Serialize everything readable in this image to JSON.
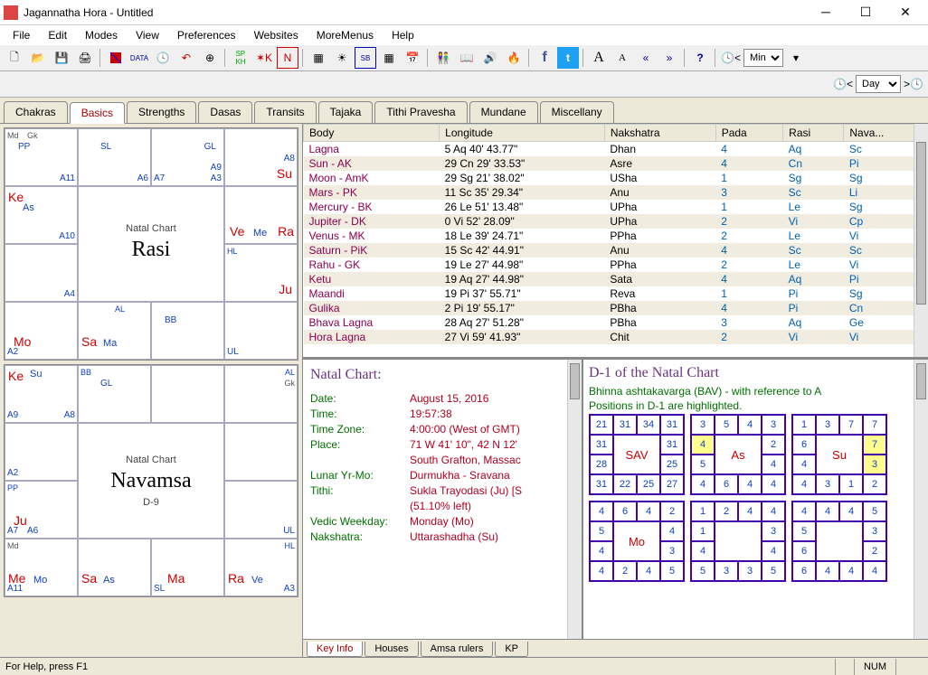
{
  "window": {
    "title": "Jagannatha Hora - Untitled"
  },
  "menu": [
    "File",
    "Edit",
    "Modes",
    "View",
    "Preferences",
    "Websites",
    "MoreMenus",
    "Help"
  ],
  "toolbar_combo1": "Min",
  "toolbar_combo2": "Day",
  "tabs": [
    "Chakras",
    "Basics",
    "Strengths",
    "Dasas",
    "Transits",
    "Tajaka",
    "Tithi Pravesha",
    "Mundane",
    "Miscellany"
  ],
  "tabs_active": 1,
  "rasi_chart": {
    "header": "Natal Chart",
    "big": "Rasi"
  },
  "navamsa_chart": {
    "header": "Natal Chart",
    "big": "Navamsa",
    "sub": "D-9"
  },
  "body_table": {
    "headers": [
      "Body",
      "Longitude",
      "Nakshatra",
      "Pada",
      "Rasi",
      "Nava..."
    ],
    "rows": [
      [
        "Lagna",
        "5 Aq 40' 43.77\"",
        "Dhan",
        "4",
        "Aq",
        "Sc"
      ],
      [
        "Sun - AK",
        "29 Cn 29' 33.53\"",
        "Asre",
        "4",
        "Cn",
        "Pi"
      ],
      [
        "Moon - AmK",
        "29 Sg 21' 38.02\"",
        "USha",
        "1",
        "Sg",
        "Sg"
      ],
      [
        "Mars - PK",
        "11 Sc 35' 29.34\"",
        "Anu",
        "3",
        "Sc",
        "Li"
      ],
      [
        "Mercury - BK",
        "26 Le 51' 13.48\"",
        "UPha",
        "1",
        "Le",
        "Sg"
      ],
      [
        "Jupiter - DK",
        "0 Vi 52' 28.09\"",
        "UPha",
        "2",
        "Vi",
        "Cp"
      ],
      [
        "Venus - MK",
        "18 Le 39' 24.71\"",
        "PPha",
        "2",
        "Le",
        "Vi"
      ],
      [
        "Saturn - PiK",
        "15 Sc 42' 44.91\"",
        "Anu",
        "4",
        "Sc",
        "Sc"
      ],
      [
        "Rahu - GK",
        "19 Le 27' 44.98\"",
        "PPha",
        "2",
        "Le",
        "Vi"
      ],
      [
        "Ketu",
        "19 Aq 27' 44.98\"",
        "Sata",
        "4",
        "Aq",
        "Pi"
      ],
      [
        "Maandi",
        "19 Pi 37' 55.71\"",
        "Reva",
        "1",
        "Pi",
        "Sg"
      ],
      [
        "Gulika",
        "2 Pi 19' 55.17\"",
        "PBha",
        "4",
        "Pi",
        "Cn"
      ],
      [
        "Bhava Lagna",
        "28 Aq 27' 51.28\"",
        "PBha",
        "3",
        "Aq",
        "Ge"
      ],
      [
        "Hora Lagna",
        "27 Vi 59' 41.93\"",
        "Chit",
        "2",
        "Vi",
        "Vi"
      ]
    ]
  },
  "natal_info": {
    "title": "Natal Chart:",
    "rows": [
      {
        "label": "Date:",
        "value": "August 15, 2016"
      },
      {
        "label": "Time:",
        "value": "19:57:38"
      },
      {
        "label": "Time Zone:",
        "value": "4:00:00 (West of GMT)"
      },
      {
        "label": "Place:",
        "value": "71 W 41' 10\", 42 N 12'"
      },
      {
        "label": "",
        "value": "South Grafton, Massac"
      },
      {
        "label": "Lunar Yr-Mo:",
        "value": "Durmukha - Sravana"
      },
      {
        "label": "Tithi:",
        "value": "Sukla Trayodasi (Ju) [S"
      },
      {
        "label": "",
        "value": "  (51.10% left)"
      },
      {
        "label": "Vedic Weekday:",
        "value": "Monday (Mo)"
      },
      {
        "label": "Nakshatra:",
        "value": "Uttarashadha (Su)"
      }
    ]
  },
  "d1_panel": {
    "title": "D-1 of the Natal Chart",
    "desc1": "Bhinna ashtakavarga (BAV) - with reference to A",
    "desc2": "Positions in D-1 are highlighted.",
    "boxes": [
      {
        "label": "SAV",
        "cells": [
          21,
          31,
          34,
          31,
          31,
          null,
          null,
          31,
          28,
          null,
          null,
          25,
          31,
          22,
          25,
          27
        ],
        "hl": []
      },
      {
        "label": "As",
        "cells": [
          3,
          5,
          4,
          3,
          4,
          null,
          null,
          2,
          5,
          null,
          null,
          4,
          4,
          6,
          4,
          4
        ],
        "hl": [
          4
        ]
      },
      {
        "label": "Su",
        "cells": [
          1,
          3,
          7,
          7,
          6,
          null,
          null,
          7,
          4,
          null,
          null,
          3,
          4,
          3,
          1,
          2
        ],
        "hl": [
          7,
          11
        ]
      },
      {
        "label": "Mo",
        "cells": [
          4,
          6,
          4,
          2,
          5,
          null,
          null,
          4,
          4,
          null,
          null,
          3,
          4,
          2,
          4,
          5
        ],
        "hl": []
      },
      {
        "label": "",
        "cells": [
          1,
          2,
          4,
          4,
          1,
          null,
          null,
          3,
          4,
          null,
          null,
          4,
          5,
          3,
          3,
          5
        ],
        "hl": []
      },
      {
        "label": "",
        "cells": [
          4,
          4,
          4,
          5,
          5,
          null,
          null,
          3,
          6,
          null,
          null,
          2,
          6,
          4,
          4,
          4
        ],
        "hl": []
      }
    ]
  },
  "bottom_tabs": [
    "Key Info",
    "Houses",
    "Amsa rulers",
    "KP"
  ],
  "bottom_tabs_active": 0,
  "status": {
    "help": "For Help, press F1",
    "num": "NUM"
  }
}
